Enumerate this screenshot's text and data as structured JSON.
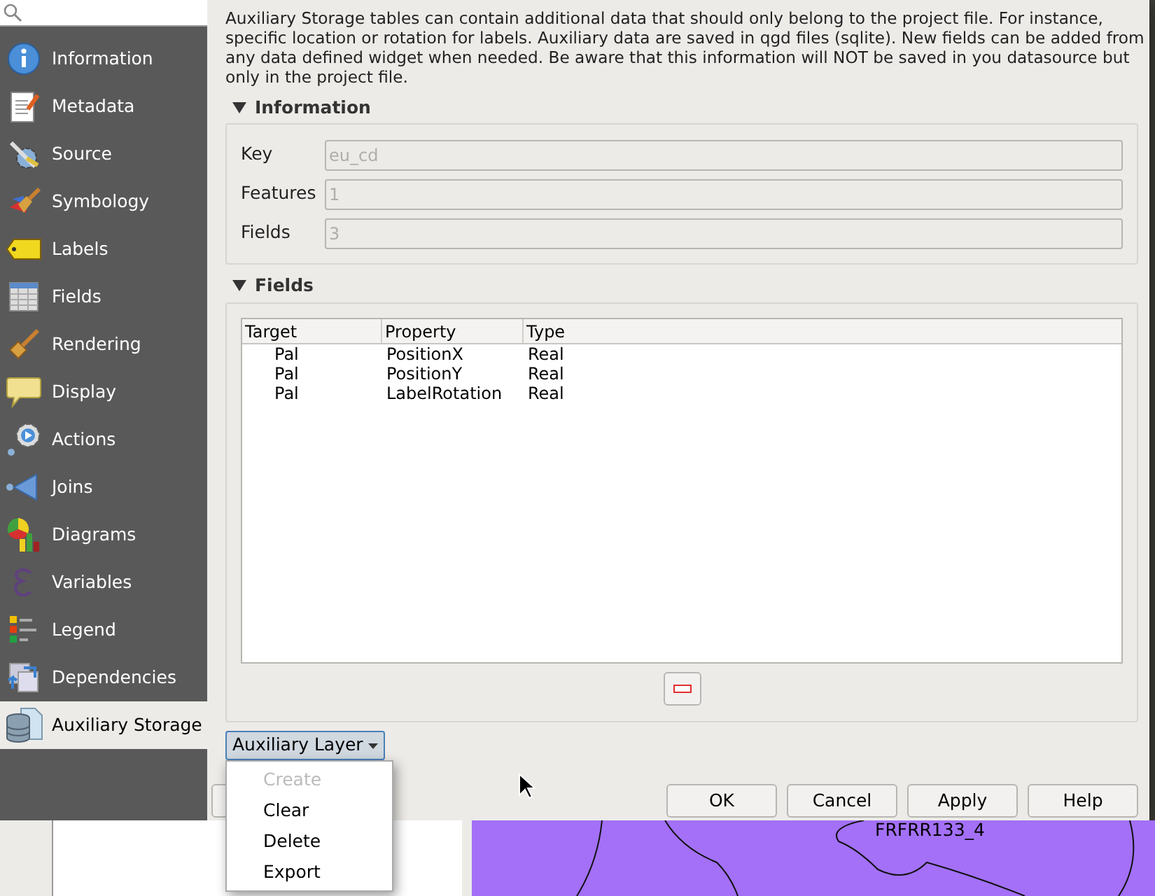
{
  "sidebar": {
    "items": [
      {
        "label": "Information",
        "selected": false
      },
      {
        "label": "Metadata",
        "selected": false
      },
      {
        "label": "Source",
        "selected": false
      },
      {
        "label": "Symbology",
        "selected": false
      },
      {
        "label": "Labels",
        "selected": false
      },
      {
        "label": "Fields",
        "selected": false
      },
      {
        "label": "Rendering",
        "selected": false
      },
      {
        "label": "Display",
        "selected": false
      },
      {
        "label": "Actions",
        "selected": false
      },
      {
        "label": "Joins",
        "selected": false
      },
      {
        "label": "Diagrams",
        "selected": false
      },
      {
        "label": "Variables",
        "selected": false
      },
      {
        "label": "Legend",
        "selected": false
      },
      {
        "label": "Dependencies",
        "selected": false
      },
      {
        "label": "Auxiliary Storage",
        "selected": true
      }
    ]
  },
  "description": "Auxiliary Storage tables can contain additional data that should only belong to the project file. For instance, specific location or rotation for labels. Auxiliary data are saved in qgd files (sqlite). New fields can be added from any data defined widget when needed. Be aware that this information will NOT be saved in you datasource but only in the project file.",
  "information": {
    "title": "Information",
    "expanded": true,
    "fields": [
      {
        "label": "Key",
        "value": "eu_cd",
        "disabled": true
      },
      {
        "label": "Features",
        "value": "1",
        "disabled": true
      },
      {
        "label": "Fields",
        "value": "3",
        "disabled": true
      }
    ]
  },
  "fields_section": {
    "title": "Fields",
    "expanded": true,
    "table": {
      "columns": [
        "Target",
        "Property",
        "Type"
      ],
      "rows": [
        [
          "Pal",
          "PositionX",
          "Real"
        ],
        [
          "Pal",
          "PositionY",
          "Real"
        ],
        [
          "Pal",
          "LabelRotation",
          "Real"
        ]
      ]
    }
  },
  "auxiliary_layer_button": "Auxiliary Layer",
  "menu": [
    {
      "label": "Create",
      "disabled": true
    },
    {
      "label": "Clear",
      "disabled": false
    },
    {
      "label": "Delete",
      "disabled": false
    },
    {
      "label": "Export",
      "disabled": false
    }
  ],
  "buttons": [
    "OK",
    "Cancel",
    "Apply",
    "Help"
  ],
  "map": {
    "label": "FRFRR133_4"
  }
}
